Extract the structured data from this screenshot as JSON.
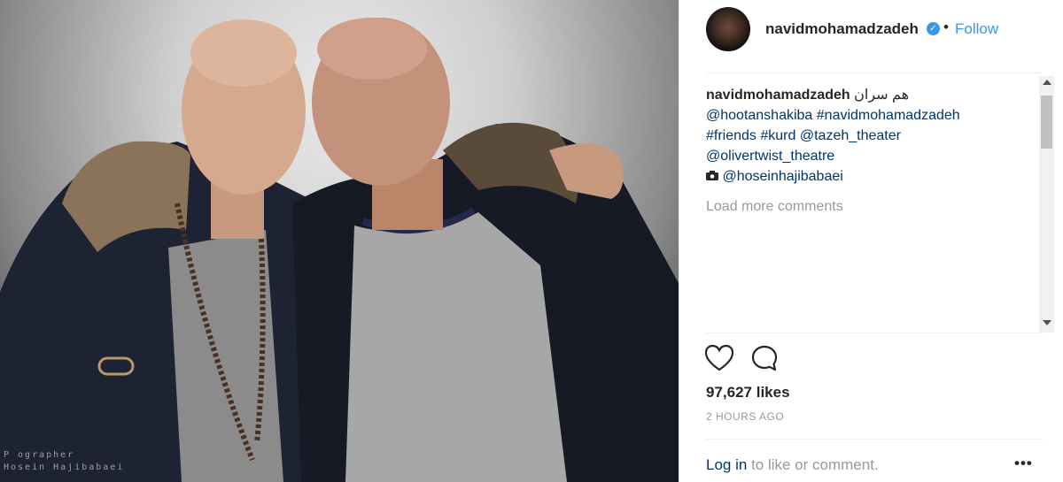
{
  "post": {
    "photo_alt_label": "post-photo",
    "watermark_line1": "P  ographer",
    "watermark_line2": "Hosein Hajibabaei"
  },
  "header": {
    "username": "navidmohamadzadeh",
    "verified_icon": "verified-badge-icon",
    "separator": "•",
    "follow_label": "Follow"
  },
  "caption": {
    "author": "navidmohamadzadeh",
    "persian_text": "هم سران",
    "mention1": "@hootanshakiba",
    "hashtag1": "#navidmohamadzadeh",
    "hashtag2": "#friends",
    "hashtag3": "#kurd",
    "mention2": "@tazeh_theater",
    "mention3": "@olivertwist_theatre",
    "camera_icon": "camera-icon",
    "mention4": "@hoseinhajibabaei"
  },
  "comments": {
    "load_more": "Load more comments"
  },
  "actions": {
    "like_icon": "heart-icon",
    "comment_icon": "comment-icon"
  },
  "stats": {
    "likes": "97,627 likes",
    "time": "2 HOURS AGO"
  },
  "footer": {
    "login_link": "Log in",
    "login_rest": " to like or comment.",
    "more_icon": "•••"
  },
  "colors": {
    "accent": "#3897f0",
    "link": "#003569",
    "muted": "#999999"
  }
}
